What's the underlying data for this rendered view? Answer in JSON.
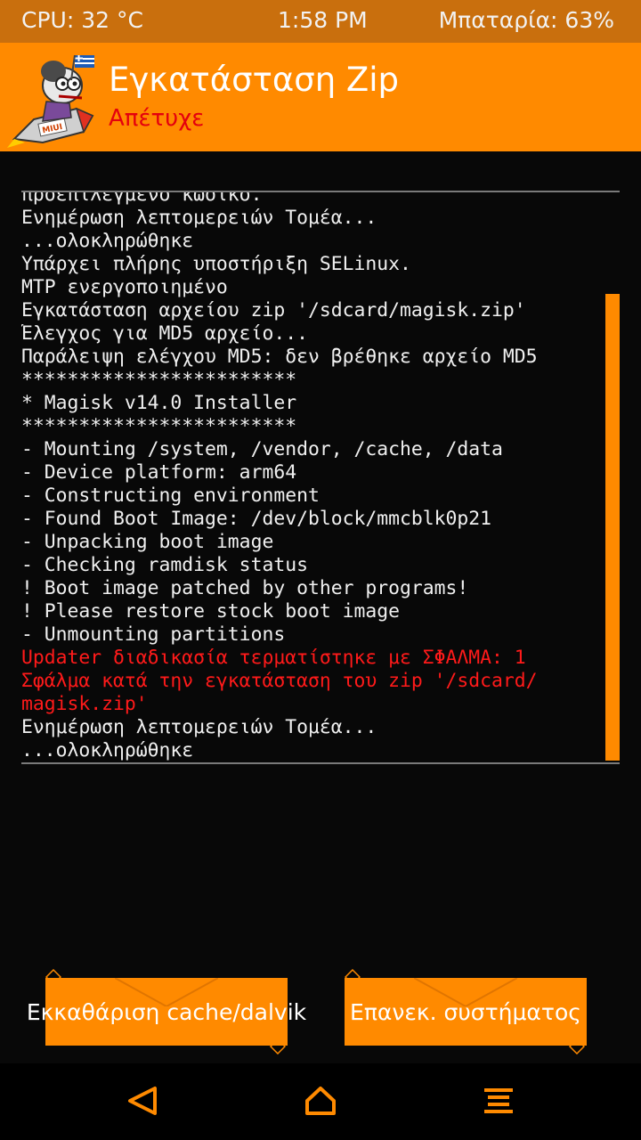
{
  "status_bar": {
    "cpu": "CPU: 32 °C",
    "time": "1:58 PM",
    "battery": "Μπαταρία: 63%"
  },
  "header": {
    "title": "Εγκατάσταση Zip",
    "subtitle": "Απέτυχε",
    "logo_text": "MIUI"
  },
  "log": {
    "lines": [
      {
        "text": "προεπιλεγμένο κωδικό.",
        "type": "normal"
      },
      {
        "text": "Ενημέρωση λεπτομερειών Τομέα...",
        "type": "normal"
      },
      {
        "text": "...ολοκληρώθηκε",
        "type": "normal"
      },
      {
        "text": "Υπάρχει πλήρης υποστήριξη SELinux.",
        "type": "normal"
      },
      {
        "text": "MTP ενεργοποιημένο",
        "type": "normal"
      },
      {
        "text": "Εγκατάσταση αρχείου zip '/sdcard/magisk.zip'",
        "type": "normal"
      },
      {
        "text": "Έλεγχος για MD5 αρχείο...",
        "type": "normal"
      },
      {
        "text": "Παράλειψη ελέγχου MD5: δεν βρέθηκε αρχείο MD5",
        "type": "normal"
      },
      {
        "text": "************************",
        "type": "normal"
      },
      {
        "text": "* Magisk v14.0 Installer",
        "type": "normal"
      },
      {
        "text": "************************",
        "type": "normal"
      },
      {
        "text": "- Mounting /system, /vendor, /cache, /data",
        "type": "normal"
      },
      {
        "text": "- Device platform: arm64",
        "type": "normal"
      },
      {
        "text": "- Constructing environment",
        "type": "normal"
      },
      {
        "text": "- Found Boot Image: /dev/block/mmcblk0p21",
        "type": "normal"
      },
      {
        "text": "- Unpacking boot image",
        "type": "normal"
      },
      {
        "text": "- Checking ramdisk status",
        "type": "normal"
      },
      {
        "text": "! Boot image patched by other programs!",
        "type": "normal"
      },
      {
        "text": "! Please restore stock boot image",
        "type": "normal"
      },
      {
        "text": "- Unmounting partitions",
        "type": "normal"
      },
      {
        "text": "Updater διαδικασία τερματίστηκε με ΣΦΑΛΜΑ: 1",
        "type": "error"
      },
      {
        "text": "Σφάλμα κατά την εγκατάσταση του zip '/sdcard/",
        "type": "error"
      },
      {
        "text": "magisk.zip'",
        "type": "error"
      },
      {
        "text": "Ενημέρωση λεπτομερειών Τομέα...",
        "type": "normal"
      },
      {
        "text": "...ολοκληρώθηκε",
        "type": "normal"
      }
    ]
  },
  "buttons": {
    "wipe_label": "Εκκαθάριση cache/dalvik",
    "reboot_label": "Επανεκ. συστήματος"
  },
  "nav": {
    "back_icon": "back-triangle-icon",
    "home_icon": "home-icon",
    "menu_icon": "menu-lines-icon"
  },
  "colors": {
    "accent": "#ff8a00",
    "status_bar": "#c96f0d",
    "error": "#ff1a1a",
    "background": "#080808"
  }
}
